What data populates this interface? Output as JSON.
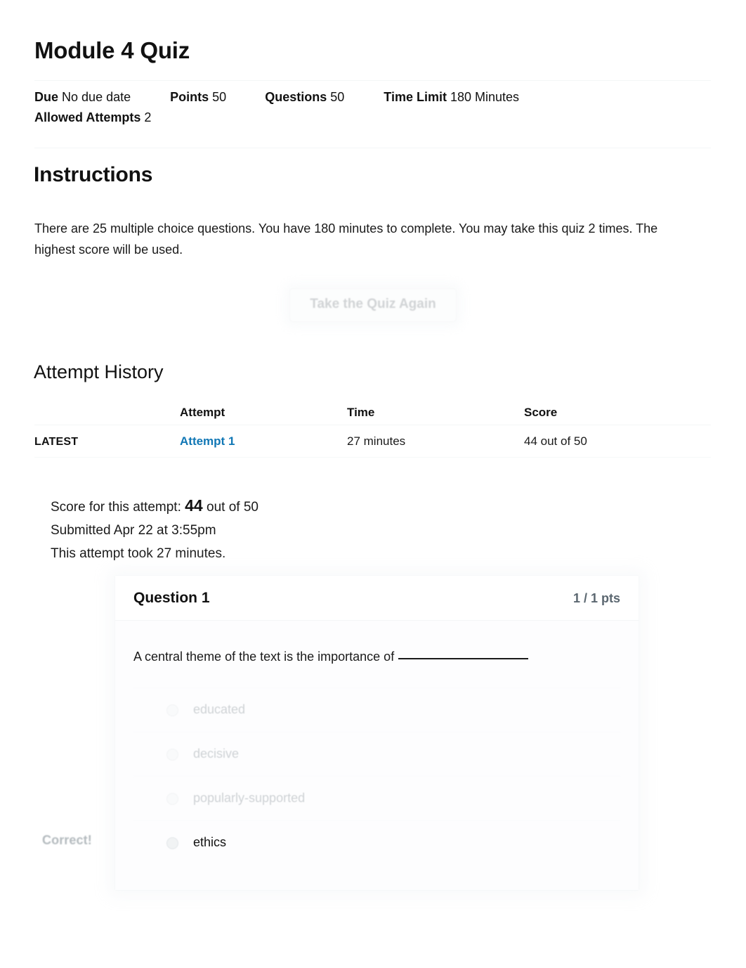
{
  "quiz": {
    "title": "Module 4 Quiz",
    "details": [
      {
        "label": "Due",
        "value": "No due date"
      },
      {
        "label": "Points",
        "value": "50"
      },
      {
        "label": "Questions",
        "value": "50"
      },
      {
        "label": "Time Limit",
        "value": "180 Minutes"
      },
      {
        "label": "Allowed Attempts",
        "value": "2"
      }
    ]
  },
  "instructions": {
    "heading": "Instructions",
    "body": "There are 25 multiple choice questions. You have 180 minutes to complete. You may take this quiz 2 times. The highest score will be used."
  },
  "actions": {
    "retake_label": "Take the Quiz Again"
  },
  "attempt_history": {
    "heading": "Attempt History",
    "columns": [
      "",
      "Attempt",
      "Time",
      "Score"
    ],
    "rows": [
      {
        "kept": "LATEST",
        "attempt": "Attempt 1",
        "time": "27 minutes",
        "score": "44 out of 50"
      }
    ]
  },
  "score_summary": {
    "score_prefix": "Score for this attempt:",
    "score_value": "44",
    "score_suffix": "out of 50",
    "submitted": "Submitted Apr 22 at 3:55pm",
    "duration": "This attempt took 27 minutes."
  },
  "question": {
    "name": "Question 1",
    "points": "1 / 1 pts",
    "text_before_blank": "A central theme of the text is the importance of",
    "answers": [
      {
        "label": "educated",
        "selected": false,
        "correct": false
      },
      {
        "label": "decisive",
        "selected": false,
        "correct": false
      },
      {
        "label": "popularly-supported",
        "selected": false,
        "correct": false
      },
      {
        "label": "ethics",
        "selected": true,
        "correct": true
      }
    ],
    "correct_flag": "Correct!"
  },
  "colors": {
    "link_blue": "#1177b5",
    "text_dark": "#1a1a1a",
    "muted_gray": "#8f989e",
    "rule_gray": "#f4f6f7"
  }
}
